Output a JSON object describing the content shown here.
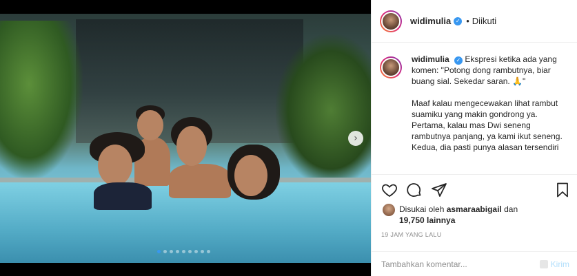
{
  "post": {
    "username": "widimulia",
    "follow_separator": "•",
    "follow_status": "Diikuti"
  },
  "caption": {
    "username": "widimulia",
    "line1": "Ekspresi ketika ada yang komen: \"Potong dong rambutnya, biar buang sial. Sekedar saran. 🙏\"",
    "para2": "Maaf kalau mengecewakan lihat rambut suamiku yang makin gondrong ya.",
    "para3": "Pertama, kalau mas Dwi seneng rambutnya panjang, ya kami ikut seneng.",
    "para4": "Kedua, dia pasti punya alasan tersendiri"
  },
  "likes": {
    "prefix": "Disukai oleh",
    "user": "asmaraabigail",
    "joiner": "dan",
    "others": "19,750 lainnya"
  },
  "timestamp": "19 JAM YANG LALU",
  "comment": {
    "placeholder": "Tambahkan komentar...",
    "send_label": "Kirim"
  },
  "carousel": {
    "total": 9,
    "active_index": 0
  },
  "icons": {
    "like": "heart-icon",
    "comment": "comment-bubble-icon",
    "share": "paper-plane-icon",
    "save": "bookmark-icon",
    "next": "chevron-right-icon",
    "verified": "verified-badge-icon"
  },
  "colors": {
    "accent": "#3897f0",
    "send_disabled": "#b2dffc",
    "muted": "#8e8e8e"
  }
}
